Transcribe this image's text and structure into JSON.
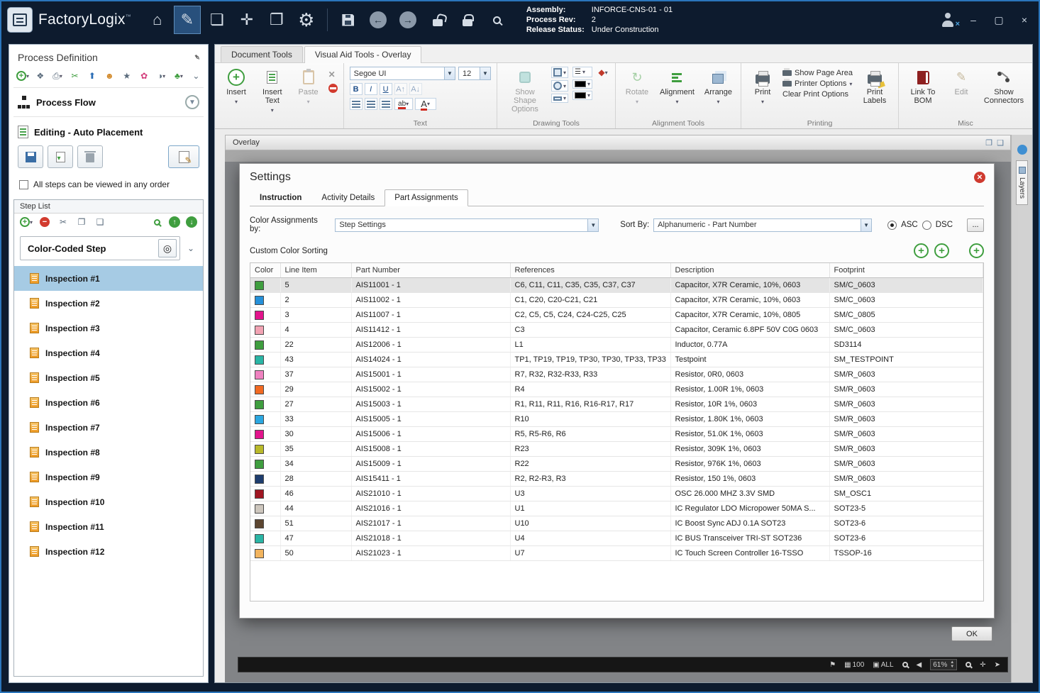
{
  "titlebar": {
    "app_name": "FactoryLogix",
    "trademark": "™",
    "assembly_label": "Assembly:",
    "assembly_value": "INFORCE-CNS-01 - 01",
    "process_rev_label": "Process Rev:",
    "process_rev_value": "2",
    "release_status_label": "Release Status:",
    "release_status_value": "Under Construction",
    "minimize": "–",
    "maximize": "▢",
    "close": "×"
  },
  "sidebar": {
    "title": "Process Definition",
    "process_flow": "Process Flow",
    "editing_header": "Editing - Auto Placement",
    "order_checkbox_label": "All steps can be viewed in any order",
    "step_list_title": "Step List",
    "step_group_label": "Color-Coded Step",
    "steps": [
      {
        "label": "Inspection #1",
        "selected": true
      },
      {
        "label": "Inspection #2"
      },
      {
        "label": "Inspection #3"
      },
      {
        "label": "Inspection #4"
      },
      {
        "label": "Inspection #5"
      },
      {
        "label": "Inspection #6"
      },
      {
        "label": "Inspection #7"
      },
      {
        "label": "Inspection #8"
      },
      {
        "label": "Inspection #9"
      },
      {
        "label": "Inspection #10"
      },
      {
        "label": "Inspection #11"
      },
      {
        "label": "Inspection #12"
      }
    ]
  },
  "ribbon": {
    "tabs": [
      {
        "label": "Document Tools",
        "active": false
      },
      {
        "label": "Visual Aid Tools - Overlay",
        "active": true
      }
    ],
    "insert_label": "Insert",
    "insert_text_label": "Insert Text",
    "paste_label": "Paste",
    "font_name": "Segoe UI",
    "font_size": "12",
    "text_group_label": "Text",
    "show_shape_options_label": "Show Shape Options",
    "drawing_group_label": "Drawing Tools",
    "rotate_label": "Rotate",
    "alignment_label": "Alignment",
    "arrange_label": "Arrange",
    "alignment_group_label": "Alignment Tools",
    "print_label": "Print",
    "show_page_area_label": "Show Page Area",
    "printer_options_label": "Printer Options",
    "clear_print_options_label": "Clear Print Options",
    "print_labels_label": "Print Labels",
    "printing_group_label": "Printing",
    "link_to_bom_label": "Link To BOM",
    "edit_label": "Edit",
    "show_connectors_label": "Show Connectors",
    "misc_group_label": "Misc"
  },
  "overlay": {
    "title": "Overlay",
    "layers_tab": "Layers",
    "ok_label": "OK"
  },
  "dialog": {
    "title": "Settings",
    "tabs": [
      {
        "label": "Instruction",
        "active": false
      },
      {
        "label": "Activity Details",
        "active": false
      },
      {
        "label": "Part Assignments",
        "active": true
      }
    ],
    "color_assignments_label": "Color Assignments by:",
    "color_assignments_value": "Step Settings",
    "sort_by_label": "Sort By:",
    "sort_by_value": "Alphanumeric - Part Number",
    "asc_label": "ASC",
    "dsc_label": "DSC",
    "more_button": "...",
    "custom_color_sorting_label": "Custom Color Sorting",
    "table": {
      "columns": [
        "Color",
        "Line Item",
        "Part Number",
        "References",
        "Description",
        "Footprint"
      ],
      "rows": [
        {
          "color": "#3f9e3f",
          "line_item": "5",
          "part_number": "AIS11001 - 1",
          "references": "C6, C11, C11, C35, C35, C37, C37",
          "description": "Capacitor,  X7R Ceramic, 10%, 0603",
          "footprint": "SM/C_0603",
          "selected": true
        },
        {
          "color": "#2590d9",
          "line_item": "2",
          "part_number": "AIS11002 - 1",
          "references": "C1, C20, C20-C21, C21",
          "description": "Capacitor,  X7R Ceramic, 10%, 0603",
          "footprint": "SM/C_0603"
        },
        {
          "color": "#e2148c",
          "line_item": "3",
          "part_number": "AIS11007 - 1",
          "references": "C2, C5, C5, C24, C24-C25, C25",
          "description": "Capacitor,  X7R Ceramic, 10%, 0805",
          "footprint": "SM/C_0805"
        },
        {
          "color": "#f2a3b3",
          "line_item": "4",
          "part_number": "AIS11412 - 1",
          "references": "C3",
          "description": "Capacitor, Ceramic 6.8PF 50V C0G 0603",
          "footprint": "SM/C_0603"
        },
        {
          "color": "#3f9e3f",
          "line_item": "22",
          "part_number": "AIS12006 - 1",
          "references": "L1",
          "description": "Inductor, 0.77A",
          "footprint": "SD3114"
        },
        {
          "color": "#2ab5a5",
          "line_item": "43",
          "part_number": "AIS14024 - 1",
          "references": "TP1, TP19, TP19, TP30, TP30, TP33, TP33",
          "description": "Testpoint",
          "footprint": "SM_TESTPOINT"
        },
        {
          "color": "#ef82c0",
          "line_item": "37",
          "part_number": "AIS15001 - 1",
          "references": "R7, R32, R32-R33, R33",
          "description": "Resistor, 0R0, 0603",
          "footprint": "SM/R_0603"
        },
        {
          "color": "#f26a22",
          "line_item": "29",
          "part_number": "AIS15002 - 1",
          "references": "R4",
          "description": "Resistor, 1.00R 1%, 0603",
          "footprint": "SM/R_0603"
        },
        {
          "color": "#3f9e3f",
          "line_item": "27",
          "part_number": "AIS15003 - 1",
          "references": "R1, R11, R11, R16, R16-R17, R17",
          "description": "Resistor, 10R 1%, 0603",
          "footprint": "SM/R_0603"
        },
        {
          "color": "#2ba7e0",
          "line_item": "33",
          "part_number": "AIS15005 - 1",
          "references": "R10",
          "description": "Resistor, 1.80K 1%, 0603",
          "footprint": "SM/R_0603"
        },
        {
          "color": "#e2148c",
          "line_item": "30",
          "part_number": "AIS15006 - 1",
          "references": "R5, R5-R6, R6",
          "description": "Resistor, 51.0K 1%, 0603",
          "footprint": "SM/R_0603"
        },
        {
          "color": "#b9b92a",
          "line_item": "35",
          "part_number": "AIS15008 - 1",
          "references": "R23",
          "description": "Resistor, 309K 1%, 0603",
          "footprint": "SM/R_0603"
        },
        {
          "color": "#3f9e3f",
          "line_item": "34",
          "part_number": "AIS15009 - 1",
          "references": "R22",
          "description": "Resistor, 976K 1%, 0603",
          "footprint": "SM/R_0603"
        },
        {
          "color": "#1d3d6e",
          "line_item": "28",
          "part_number": "AIS15411 - 1",
          "references": "R2, R2-R3, R3",
          "description": "Resistor, 150 1%, 0603",
          "footprint": "SM/R_0603"
        },
        {
          "color": "#a01622",
          "line_item": "46",
          "part_number": "AIS21010 - 1",
          "references": "U3",
          "description": "OSC 26.000 MHZ 3.3V SMD",
          "footprint": "SM_OSC1"
        },
        {
          "color": "#cdc6bd",
          "line_item": "44",
          "part_number": "AIS21016 - 1",
          "references": "U1",
          "description": "IC Regulator LDO Micropower 50MA S...",
          "footprint": "SOT23-5"
        },
        {
          "color": "#5d4631",
          "line_item": "51",
          "part_number": "AIS21017 - 1",
          "references": "U10",
          "description": "IC Boost Sync ADJ 0.1A SOT23",
          "footprint": "SOT23-6"
        },
        {
          "color": "#2ab5a5",
          "line_item": "47",
          "part_number": "AIS21018 - 1",
          "references": "U4",
          "description": "IC BUS Transceiver TRI-ST SOT236",
          "footprint": "SOT23-6"
        },
        {
          "color": "#f2b45e",
          "line_item": "50",
          "part_number": "AIS21023 - 1",
          "references": "U7",
          "description": "IC Touch Screen Controller 16-TSSO",
          "footprint": "TSSOP-16"
        }
      ]
    }
  },
  "statusbar": {
    "grid": "100",
    "all": "ALL",
    "zoom": "61%"
  }
}
